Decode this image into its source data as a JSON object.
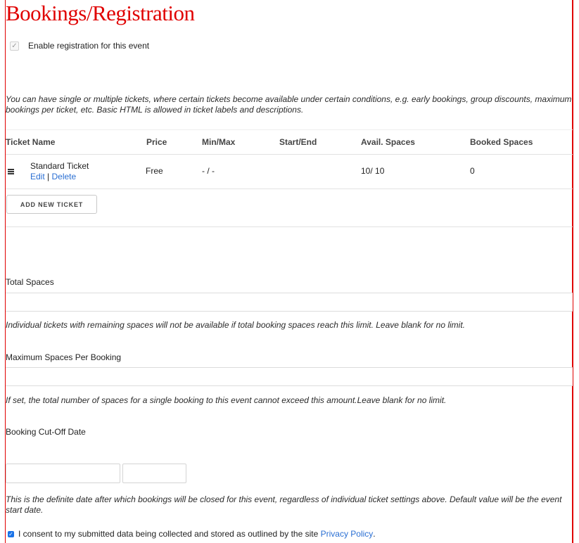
{
  "page_title": "Bookings/Registration",
  "enable_registration": {
    "label": "Enable registration for this event",
    "checked": true
  },
  "tickets_description": "You can have single or multiple tickets, where certain tickets become available under certain conditions, e.g. early bookings, group discounts, maximum bookings per ticket, etc. Basic HTML is allowed in ticket labels and descriptions.",
  "tickets_table": {
    "headers": {
      "name": "Ticket Name",
      "price": "Price",
      "minmax": "Min/Max",
      "startend": "Start/End",
      "avail": "Avail. Spaces",
      "booked": "Booked Spaces"
    },
    "rows": [
      {
        "name": "Standard Ticket",
        "edit": "Edit",
        "separator": "|",
        "delete": "Delete",
        "price": "Free",
        "minmax": "- / -",
        "startend": "",
        "avail": "10/ 10",
        "booked": "0"
      }
    ]
  },
  "add_ticket_button": "ADD NEW TICKET",
  "total_spaces": {
    "label": "Total Spaces",
    "value": "",
    "help": "Individual tickets with remaining spaces will not be available if total booking spaces reach this limit. Leave blank for no limit."
  },
  "max_per_booking": {
    "label": "Maximum Spaces Per Booking",
    "value": "",
    "help": "If set, the total number of spaces for a single booking to this event cannot exceed this amount.Leave blank for no limit."
  },
  "cutoff": {
    "label": "Booking Cut-Off Date",
    "date_value": "",
    "time_value": "",
    "help": "This is the definite date after which bookings will be closed for this event, regardless of individual ticket settings above. Default value will be the event start date."
  },
  "consent": {
    "text": "I consent to my submitted data being collected and stored as outlined by the site",
    "link": "Privacy Policy",
    "suffix": ".",
    "checked": true
  },
  "colors": {
    "title": "#e00000",
    "link": "#2a6fd3",
    "frame": "#e00000"
  }
}
